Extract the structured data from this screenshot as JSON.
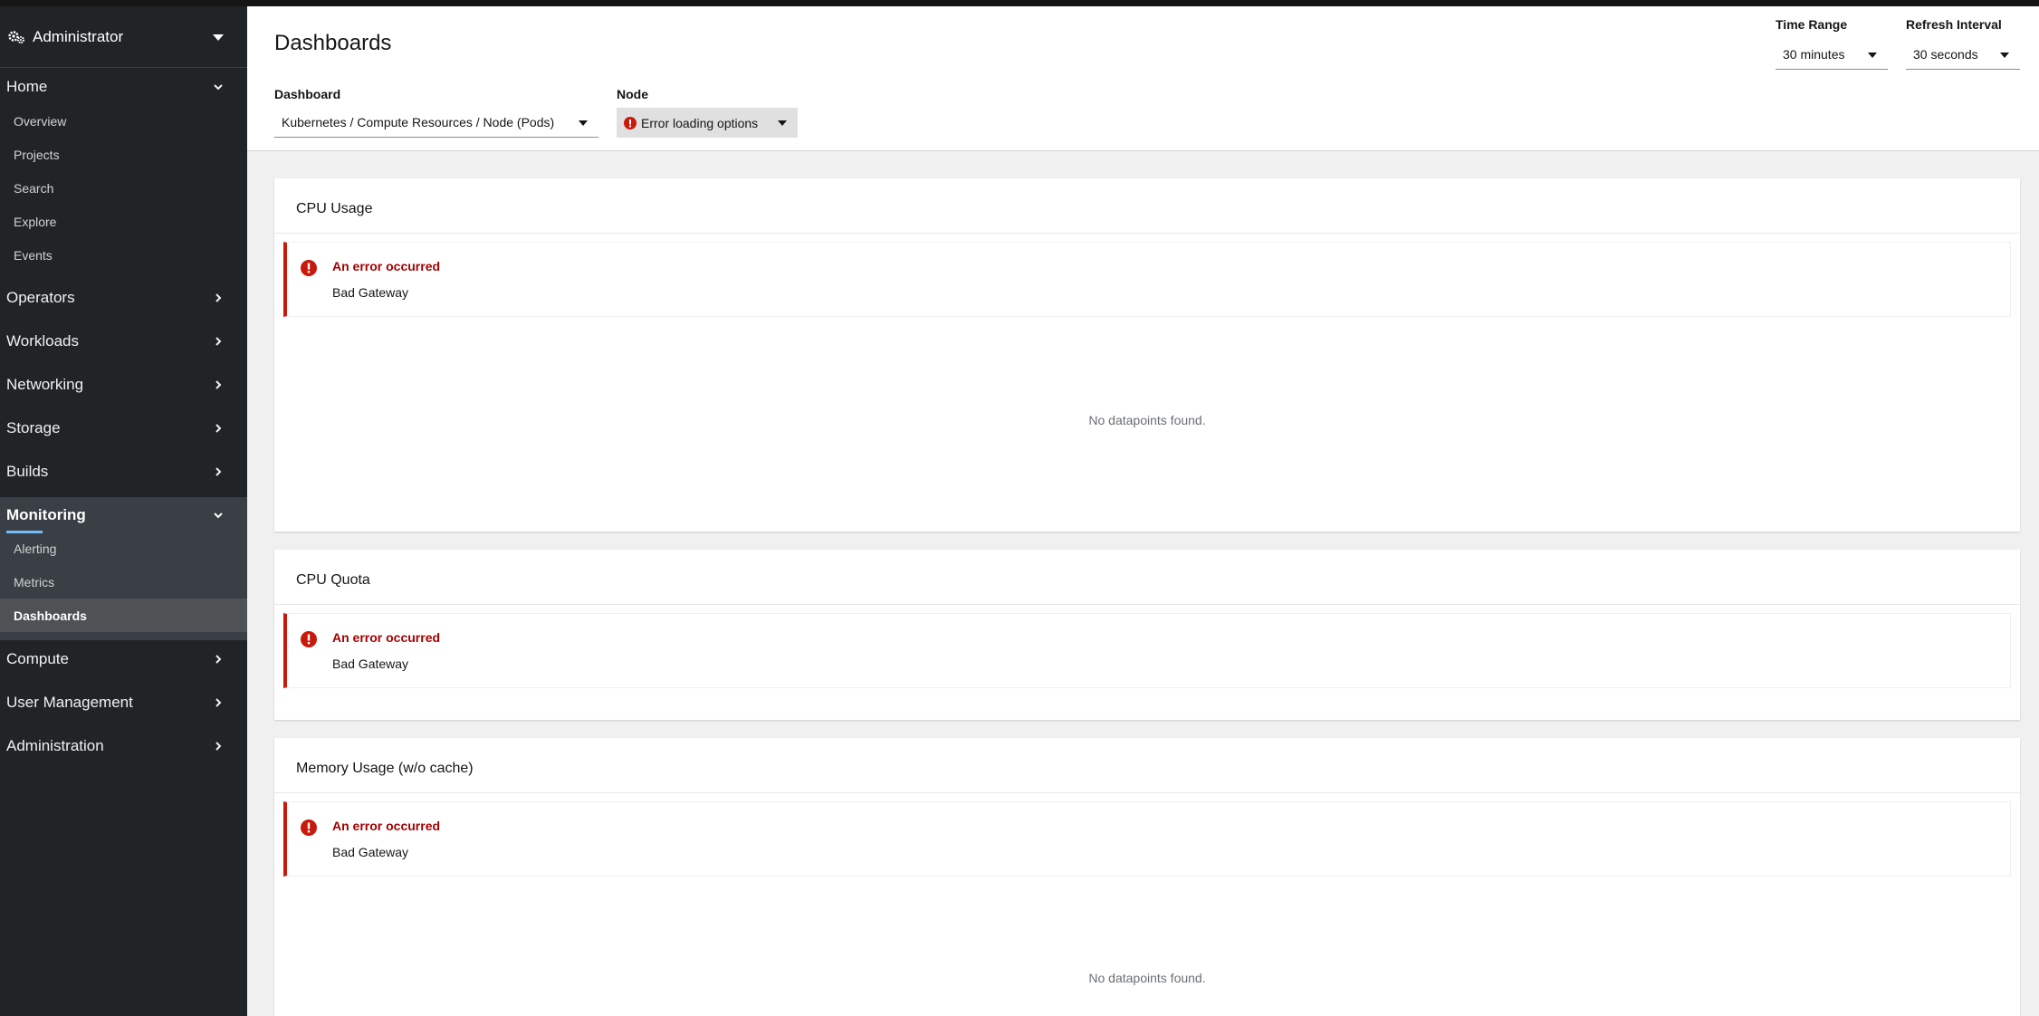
{
  "perspective": {
    "label": "Administrator",
    "icon": "gears-icon"
  },
  "sidebar": {
    "sections": [
      {
        "label": "Home",
        "expanded": true,
        "items": [
          "Overview",
          "Projects",
          "Search",
          "Explore",
          "Events"
        ]
      },
      {
        "label": "Operators",
        "expanded": false
      },
      {
        "label": "Workloads",
        "expanded": false
      },
      {
        "label": "Networking",
        "expanded": false
      },
      {
        "label": "Storage",
        "expanded": false
      },
      {
        "label": "Builds",
        "expanded": false
      },
      {
        "label": "Monitoring",
        "expanded": true,
        "items": [
          "Alerting",
          "Metrics",
          "Dashboards"
        ],
        "active_item": "Dashboards"
      },
      {
        "label": "Compute",
        "expanded": false
      },
      {
        "label": "User Management",
        "expanded": false
      },
      {
        "label": "Administration",
        "expanded": false
      }
    ]
  },
  "header": {
    "title": "Dashboards",
    "dashboard": {
      "label": "Dashboard",
      "value": "Kubernetes / Compute Resources / Node (Pods)"
    },
    "node": {
      "label": "Node",
      "value": "Error loading options"
    },
    "time_range": {
      "label": "Time Range",
      "value": "30 minutes"
    },
    "refresh_interval": {
      "label": "Refresh Interval",
      "value": "30 seconds"
    }
  },
  "panels": [
    {
      "title": "CPU Usage",
      "error_title": "An error occurred",
      "error_body": "Bad Gateway",
      "empty_text": "No datapoints found."
    },
    {
      "title": "CPU Quota",
      "error_title": "An error occurred",
      "error_body": "Bad Gateway"
    },
    {
      "title": "Memory Usage (w/o cache)",
      "error_title": "An error occurred",
      "error_body": "Bad Gateway",
      "empty_text": "No datapoints found."
    }
  ],
  "colors": {
    "danger": "#c9190b",
    "danger_text": "#a30000",
    "sidebar_bg": "#212427",
    "active_underline": "#73bcf7"
  }
}
